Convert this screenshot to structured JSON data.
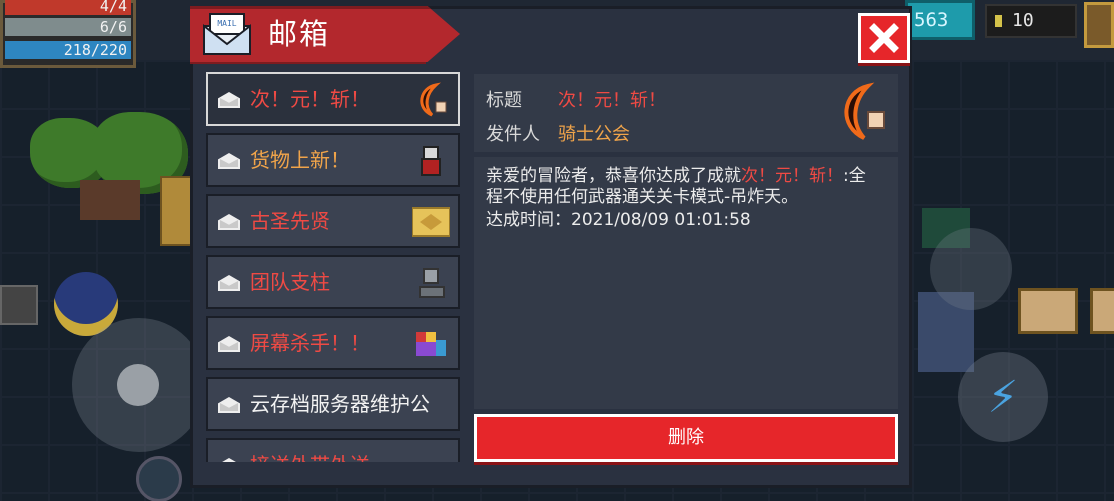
{
  "hud": {
    "hp": "4/4",
    "armor": "6/6",
    "energy": "218/220",
    "gems": "563",
    "coins": "10"
  },
  "mailbox": {
    "title": "邮箱",
    "close_icon": "close-x-icon",
    "items": [
      {
        "label": "次！元！斩！",
        "color": "red",
        "icon": "crescent-blade-icon",
        "selected": true
      },
      {
        "label": "货物上新！",
        "color": "orange",
        "icon": "merchant-icon"
      },
      {
        "label": "古圣先贤",
        "color": "red",
        "icon": "gold-tile-icon"
      },
      {
        "label": "团队支柱",
        "color": "red",
        "icon": "knight-helmet-icon"
      },
      {
        "label": "屏幕杀手！！",
        "color": "red",
        "icon": "pixel-art-icon"
      },
      {
        "label": "云存档服务器维护公",
        "color": "white",
        "icon": ""
      },
      {
        "label": "接送外带外送",
        "color": "red",
        "icon": ""
      }
    ],
    "detail": {
      "subject_label": "标题",
      "subject_value": "次！元！斩！",
      "sender_label": "发件人",
      "sender_value": "骑士公会",
      "message_intro": "亲爱的冒险者，恭喜你达成了成就",
      "message_highlight": "次！元！斩！",
      "message_rest": ":全程不使用任何武器通关关卡模式-吊炸天。",
      "time_label": "达成时间：",
      "time_value": "2021/08/09 01:01:58",
      "reward_icon": "crescent-blade-icon"
    },
    "delete_label": "删除"
  },
  "colors": {
    "accent_red": "#e6262a",
    "text_red": "#ef4a44",
    "text_orange": "#f0a44a"
  }
}
